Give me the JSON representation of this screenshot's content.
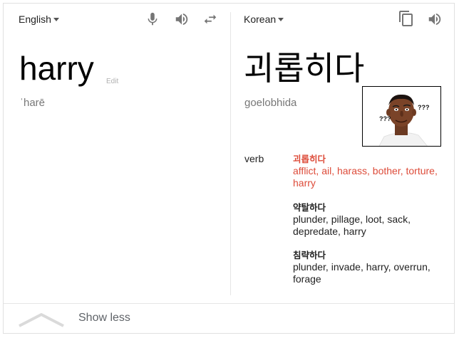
{
  "source": {
    "language": "English",
    "word": "harry",
    "edit_label": "Edit",
    "phonetic": "ˈharē"
  },
  "target": {
    "language": "Korean",
    "word": "괴롭히다",
    "romanization": "goelobhida"
  },
  "meme": {
    "marks_left": "???",
    "marks_right": "???"
  },
  "dictionary": {
    "part_of_speech": "verb",
    "entries": [
      {
        "headword": "괴롭히다",
        "synonyms": "afflict, ail, harass, bother, torture, harry"
      },
      {
        "headword": "약탈하다",
        "synonyms": "plunder, pillage, loot, sack, depredate, harry"
      },
      {
        "headword": "침략하다",
        "synonyms": "plunder, invade, harry, overrun, forage"
      }
    ]
  },
  "footer": {
    "show_less_label": "Show less"
  },
  "colors": {
    "highlight": "#dd4b39",
    "icon": "#757575",
    "divider": "#e6e6e6"
  },
  "icons": [
    "caret-down-icon",
    "microphone-icon",
    "speaker-icon",
    "swap-icon",
    "copy-icon",
    "chevron-up-icon"
  ]
}
